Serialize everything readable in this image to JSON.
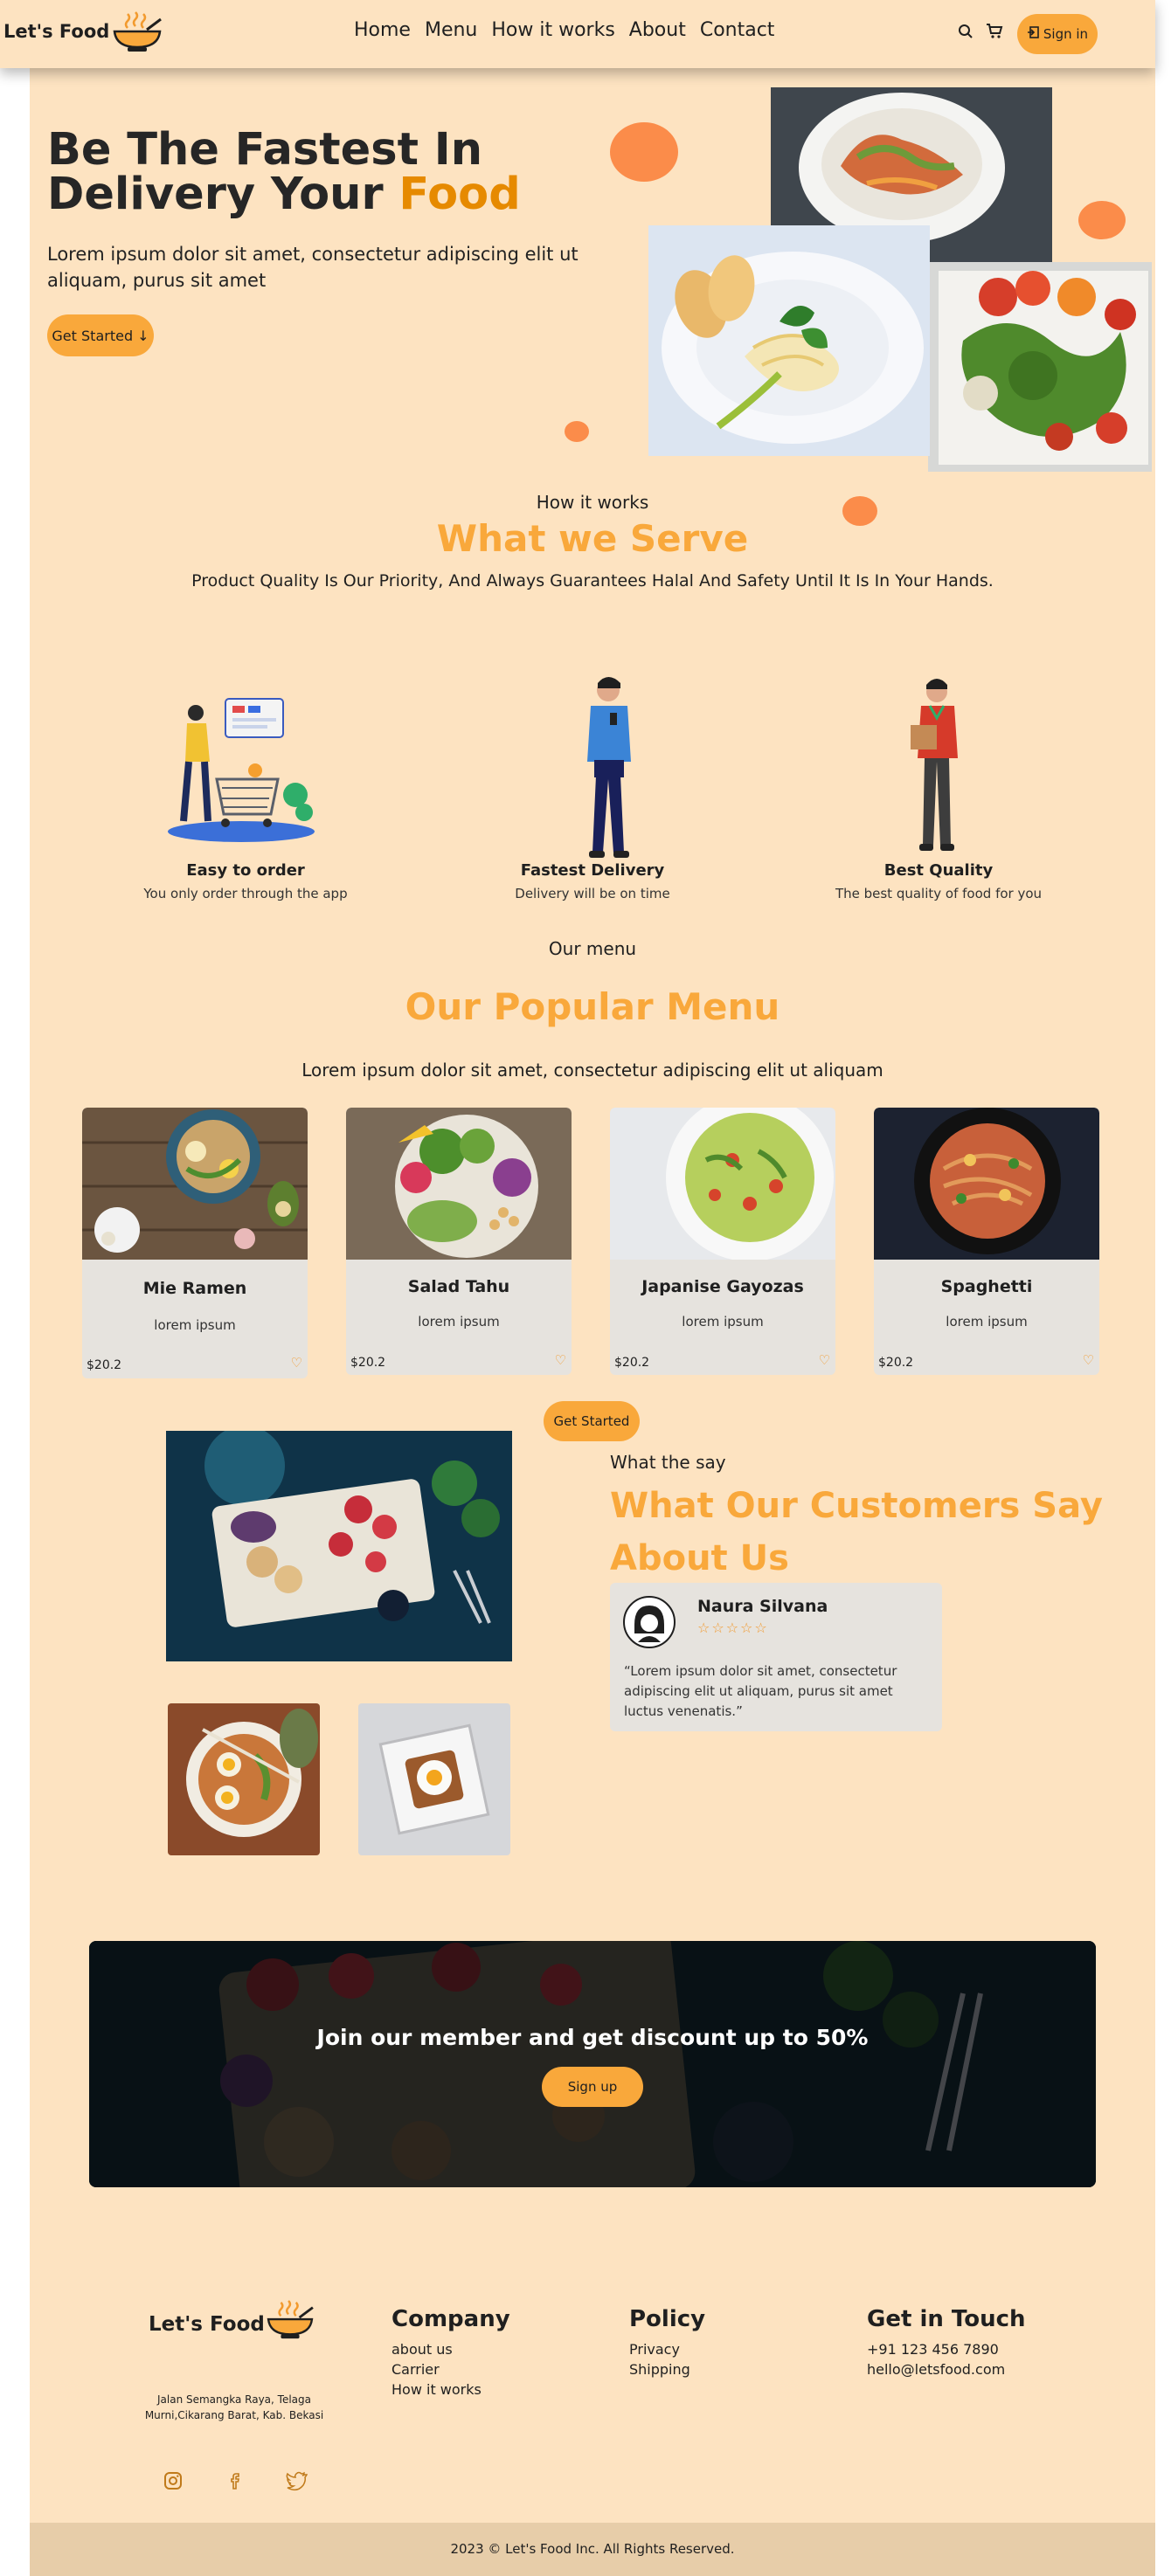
{
  "nav": {
    "brand": "Let's Food",
    "links": [
      "Home",
      "Menu",
      "How it works",
      "About",
      "Contact"
    ],
    "signin_label": "Sign in"
  },
  "hero": {
    "title_line1": "Be The Fastest In",
    "title_line2": "Delivery Your ",
    "title_accent": "Food",
    "subtitle": "Lorem ipsum dolor sit amet, consectetur adipiscing elit ut aliquam, purus sit amet",
    "cta_label": "Get Started ↓"
  },
  "how": {
    "kicker": "How it works",
    "title": "What we Serve",
    "subtitle": "Product Quality Is Our Priority, And Always Guarantees Halal And Safety Until It Is In Your Hands.",
    "features": [
      {
        "title": "Easy to order",
        "desc": "You only order through the app"
      },
      {
        "title": "Fastest Delivery",
        "desc": "Delivery will be on time"
      },
      {
        "title": "Best Quality",
        "desc": "The best quality of food for you"
      }
    ]
  },
  "menu": {
    "kicker": "Our menu",
    "title": "Our Popular Menu",
    "subtitle": "Lorem ipsum dolor sit amet, consectetur adipiscing elit ut aliquam",
    "items": [
      {
        "name": "Mie Ramen",
        "desc": "lorem ipsum",
        "price": "$20.2"
      },
      {
        "name": "Salad Tahu",
        "desc": "lorem ipsum",
        "price": "$20.2"
      },
      {
        "name": "Japanise Gayozas",
        "desc": "lorem ipsum",
        "price": "$20.2"
      },
      {
        "name": "Spaghetti",
        "desc": "lorem ipsum",
        "price": "$20.2"
      }
    ],
    "cta_label": "Get Started"
  },
  "testimonials": {
    "kicker": "What the say",
    "title_line1": "What Our Customers Say",
    "title_line2": "About Us",
    "reviewer": "Naura Silvana",
    "stars": "☆☆☆☆☆",
    "quote": "“Lorem ipsum dolor sit amet, consectetur adipiscing elit ut aliquam, purus sit amet luctus venenatis.”"
  },
  "banner": {
    "title": "Join our member and get discount up to 50%",
    "cta_label": "Sign up"
  },
  "footer": {
    "brand": "Let's Food",
    "address_line1": "Jalan Semangka Raya, Telaga",
    "address_line2": "Murni,Cikarang Barat, Kab. Bekasi",
    "company_title": "Company",
    "company_links": [
      "about us",
      "Carrier",
      "How it works"
    ],
    "policy_title": "Policy",
    "policy_links": [
      "Privacy",
      "Shipping"
    ],
    "contact_title": "Get in Touch",
    "phone": "+91 123 456 7890",
    "email": "hello@letsfood.com",
    "copyright": "2023 © Let's Food Inc. All Rights Reserved."
  },
  "colors": {
    "page_bg": "#fde3c1",
    "accent": "#f9a83b",
    "accent_dark": "#e68a00",
    "dot": "#fb8c4a",
    "card_bg": "#e6e3de",
    "copyright_bg": "#e7cda9"
  },
  "icons": [
    "bowl-logo-icon",
    "search-icon",
    "cart-icon",
    "login-icon",
    "heart-icon",
    "star-icon",
    "instagram-icon",
    "facebook-icon",
    "twitter-icon"
  ]
}
